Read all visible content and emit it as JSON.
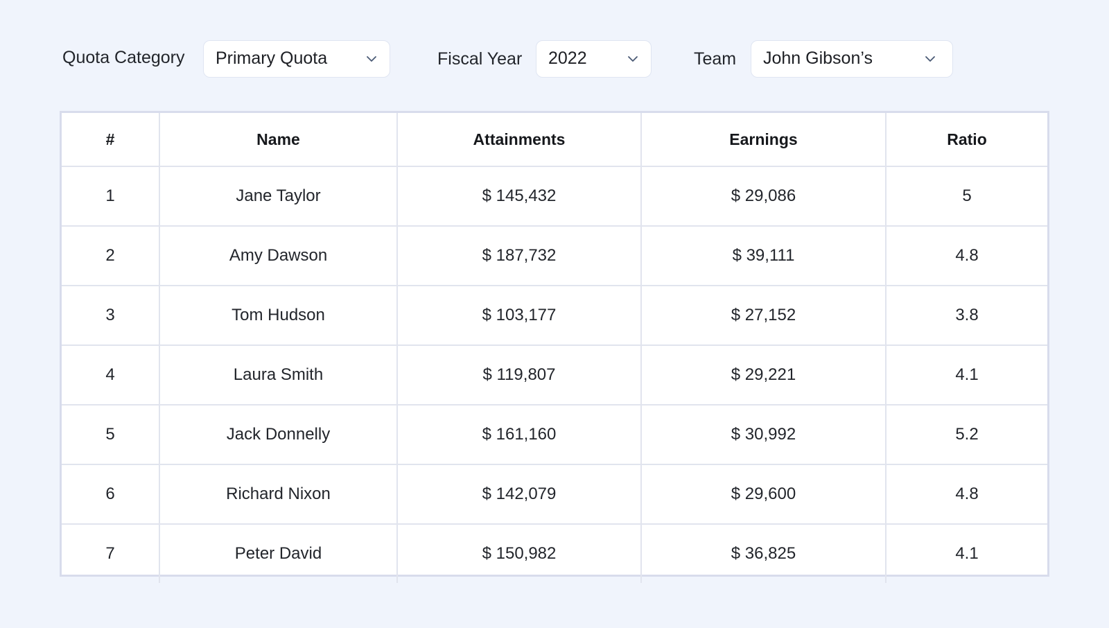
{
  "filters": {
    "quota_category": {
      "label": "Quota Category",
      "value": "Primary Quota"
    },
    "fiscal_year": {
      "label": "Fiscal Year",
      "value": "2022"
    },
    "team": {
      "label": "Team",
      "value": "John Gibson’s"
    }
  },
  "table": {
    "headers": [
      "#",
      "Name",
      "Attainments",
      "Earnings",
      "Ratio"
    ],
    "rows": [
      [
        "1",
        "Jane Taylor",
        "$ 145,432",
        "$ 29,086",
        "5"
      ],
      [
        "2",
        "Amy Dawson",
        "$ 187,732",
        "$ 39,111",
        "4.8"
      ],
      [
        "3",
        "Tom Hudson",
        "$ 103,177",
        "$ 27,152",
        "3.8"
      ],
      [
        "4",
        "Laura Smith",
        "$ 119,807",
        "$ 29,221",
        "4.1"
      ],
      [
        "5",
        "Jack Donnelly",
        "$ 161,160",
        "$ 30,992",
        "5.2"
      ],
      [
        "6",
        "Richard Nixon",
        "$ 142,079",
        "$ 29,600",
        "4.8"
      ],
      [
        "7",
        "Peter David",
        "$ 150,982",
        "$ 36,825",
        "4.1"
      ]
    ]
  },
  "icons": {
    "dropdown": "chevron-down-icon"
  },
  "colors": {
    "background": "#f0f4fc",
    "table_border": "#d8dcec",
    "cell_border": "#e1e4ee",
    "chevron": "#4a5a75"
  }
}
